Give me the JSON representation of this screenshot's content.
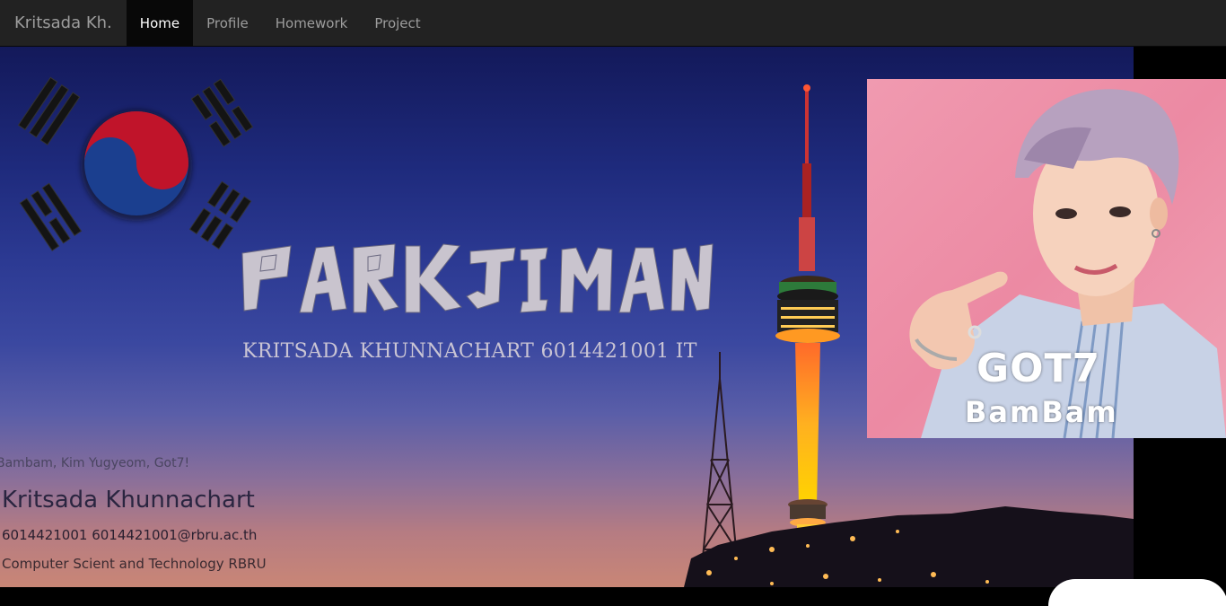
{
  "navbar": {
    "brand": "Kritsada Kh.",
    "items": [
      {
        "label": "Home",
        "active": true
      },
      {
        "label": "Profile",
        "active": false
      },
      {
        "label": "Homework",
        "active": false
      },
      {
        "label": "Project",
        "active": false
      }
    ]
  },
  "hero": {
    "title": "PARK JI MAN",
    "subtitle": "KRITSADA KHUNNACHART 6014421001 IT",
    "favorites": "Bambam, Kim Yugyeom, Got7!",
    "name": "Kritsada Khunnachart",
    "contact": "6014421001 6014421001@rbru.ac.th",
    "faculty": "Computer Scient and Technology RBRU"
  },
  "photo": {
    "group": "GOT7",
    "member": "BamBam"
  },
  "colors": {
    "navbar_bg": "#222222",
    "nav_active_bg": "#080808",
    "flag_red": "#c0142a",
    "flag_blue": "#1b3f8f"
  }
}
